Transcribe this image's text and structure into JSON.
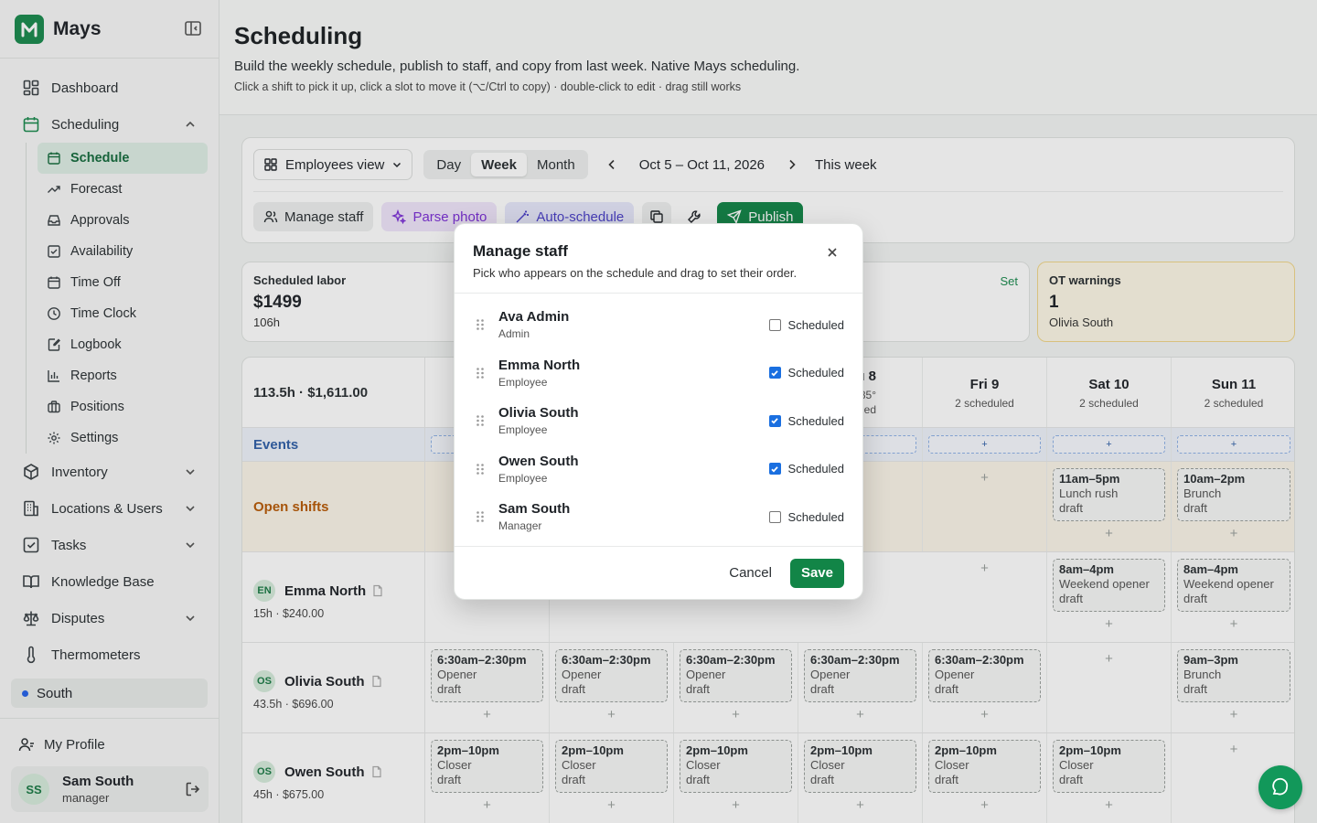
{
  "app": {
    "name": "Mays"
  },
  "sidebar": {
    "nav": [
      {
        "label": "Dashboard"
      },
      {
        "label": "Scheduling"
      }
    ],
    "scheduling_sub": [
      {
        "label": "Schedule"
      },
      {
        "label": "Forecast"
      },
      {
        "label": "Approvals"
      },
      {
        "label": "Availability"
      },
      {
        "label": "Time Off"
      },
      {
        "label": "Time Clock"
      },
      {
        "label": "Logbook"
      },
      {
        "label": "Reports"
      },
      {
        "label": "Positions"
      },
      {
        "label": "Settings"
      }
    ],
    "nav_more": [
      {
        "label": "Inventory"
      },
      {
        "label": "Locations & Users"
      },
      {
        "label": "Tasks"
      },
      {
        "label": "Knowledge Base"
      },
      {
        "label": "Disputes"
      },
      {
        "label": "Thermometers"
      }
    ],
    "location": "South",
    "profile_link": "My Profile",
    "user": {
      "initials": "SS",
      "name": "Sam South",
      "role": "manager"
    }
  },
  "header": {
    "title": "Scheduling",
    "subtitle": "Build the weekly schedule, publish to staff, and copy from last week. Native Mays scheduling.",
    "hint": "Click a shift to pick it up, click a slot to move it (⌥/Ctrl to copy) · double-click to edit · drag still works"
  },
  "toolbar": {
    "view_select": "Employees view",
    "range_tabs": [
      "Day",
      "Week",
      "Month"
    ],
    "active_range": "Week",
    "date_range": "Oct 5 – Oct 11, 2026",
    "this_week": "This week",
    "manage_staff": "Manage staff",
    "parse_photo": "Parse photo",
    "auto_schedule": "Auto-schedule",
    "publish": "Publish"
  },
  "stats": {
    "labor": {
      "label": "Scheduled labor",
      "value": "$1499",
      "sub": "106h"
    },
    "set_link": "Set",
    "ot": {
      "label": "OT warnings",
      "value": "1",
      "sub": "Olivia South"
    }
  },
  "grid": {
    "summary": "113.5h · $1,611.00",
    "days": [
      {
        "name": "",
        "count": ""
      },
      {
        "name": "",
        "count": ""
      },
      {
        "name": "",
        "count": ""
      },
      {
        "name": "u 8",
        "count": "uled",
        "weather": "85°"
      },
      {
        "name": "Fri 9",
        "count": "2 scheduled"
      },
      {
        "name": "Sat 10",
        "count": "2 scheduled"
      },
      {
        "name": "Sun 11",
        "count": "2 scheduled"
      }
    ],
    "events_label": "Events",
    "event_add": "+",
    "open_label": "Open shifts",
    "open_shifts": {
      "sat": {
        "time": "11am–5pm",
        "name": "Lunch rush",
        "status": "draft"
      },
      "sun": {
        "time": "10am–2pm",
        "name": "Brunch",
        "status": "draft"
      }
    },
    "employees": [
      {
        "initials": "EN",
        "name": "Emma North",
        "sub": "15h · $240.00",
        "shifts": {
          "sat": {
            "time": "8am–4pm",
            "name": "Weekend opener",
            "status": "draft"
          },
          "sun": {
            "time": "8am–4pm",
            "name": "Weekend opener",
            "status": "draft"
          }
        }
      },
      {
        "initials": "OS",
        "name": "Olivia South",
        "sub": "43.5h · $696.00",
        "shifts": {
          "mon": {
            "time": "6:30am–2:30pm",
            "name": "Opener",
            "status": "draft"
          },
          "tue": {
            "time": "6:30am–2:30pm",
            "name": "Opener",
            "status": "draft"
          },
          "wed": {
            "time": "6:30am–2:30pm",
            "name": "Opener",
            "status": "draft"
          },
          "thu": {
            "time": "6:30am–2:30pm",
            "name": "Opener",
            "status": "draft"
          },
          "fri": {
            "time": "6:30am–2:30pm",
            "name": "Opener",
            "status": "draft"
          },
          "sun": {
            "time": "9am–3pm",
            "name": "Brunch",
            "status": "draft"
          }
        }
      },
      {
        "initials": "OS",
        "name": "Owen South",
        "sub": "45h · $675.00",
        "shifts": {
          "mon": {
            "time": "2pm–10pm",
            "name": "Closer",
            "status": "draft"
          },
          "tue": {
            "time": "2pm–10pm",
            "name": "Closer",
            "status": "draft"
          },
          "wed": {
            "time": "2pm–10pm",
            "name": "Closer",
            "status": "draft"
          },
          "thu": {
            "time": "2pm–10pm",
            "name": "Closer",
            "status": "draft"
          },
          "fri": {
            "time": "2pm–10pm",
            "name": "Closer",
            "status": "draft"
          },
          "sat": {
            "time": "2pm–10pm",
            "name": "Closer",
            "status": "draft"
          }
        }
      }
    ],
    "plus": "+"
  },
  "modal": {
    "title": "Manage staff",
    "description": "Pick who appears on the schedule and drag to set their order.",
    "checkbox_label": "Scheduled",
    "staff": [
      {
        "name": "Ava Admin",
        "role": "Admin",
        "scheduled": false
      },
      {
        "name": "Emma North",
        "role": "Employee",
        "scheduled": true
      },
      {
        "name": "Olivia South",
        "role": "Employee",
        "scheduled": true
      },
      {
        "name": "Owen South",
        "role": "Employee",
        "scheduled": true
      },
      {
        "name": "Sam South",
        "role": "Manager",
        "scheduled": false
      }
    ],
    "cancel": "Cancel",
    "save": "Save"
  },
  "colors": {
    "brand": "#128547",
    "accent_purple": "#7c2fd6",
    "accent_indigo": "#4a3fc9",
    "warning": "#f1d78a"
  }
}
